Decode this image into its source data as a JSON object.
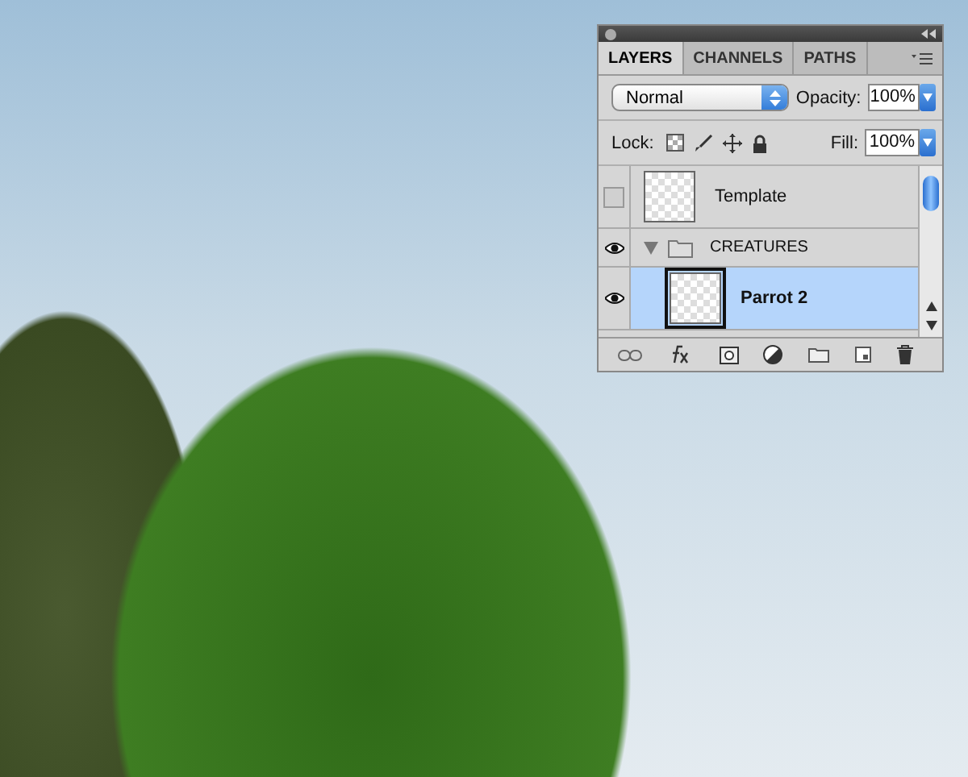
{
  "panel": {
    "tabs": [
      {
        "label": "LAYERS",
        "selected": true
      },
      {
        "label": "CHANNELS",
        "selected": false
      },
      {
        "label": "PATHS",
        "selected": false
      }
    ],
    "blend_mode": "Normal",
    "opacity_label": "Opacity:",
    "opacity": "100%",
    "lock_label": "Lock:",
    "fill_label": "Fill:",
    "fill": "100%",
    "layers": [
      {
        "kind": "layer",
        "name": "Template",
        "visible": false,
        "selected": false
      },
      {
        "kind": "group",
        "name": "CREATURES",
        "visible": true,
        "expanded": true,
        "selected": false,
        "children": [
          {
            "kind": "layer",
            "name": "Parrot 2",
            "visible": true,
            "selected": true
          }
        ]
      }
    ]
  }
}
